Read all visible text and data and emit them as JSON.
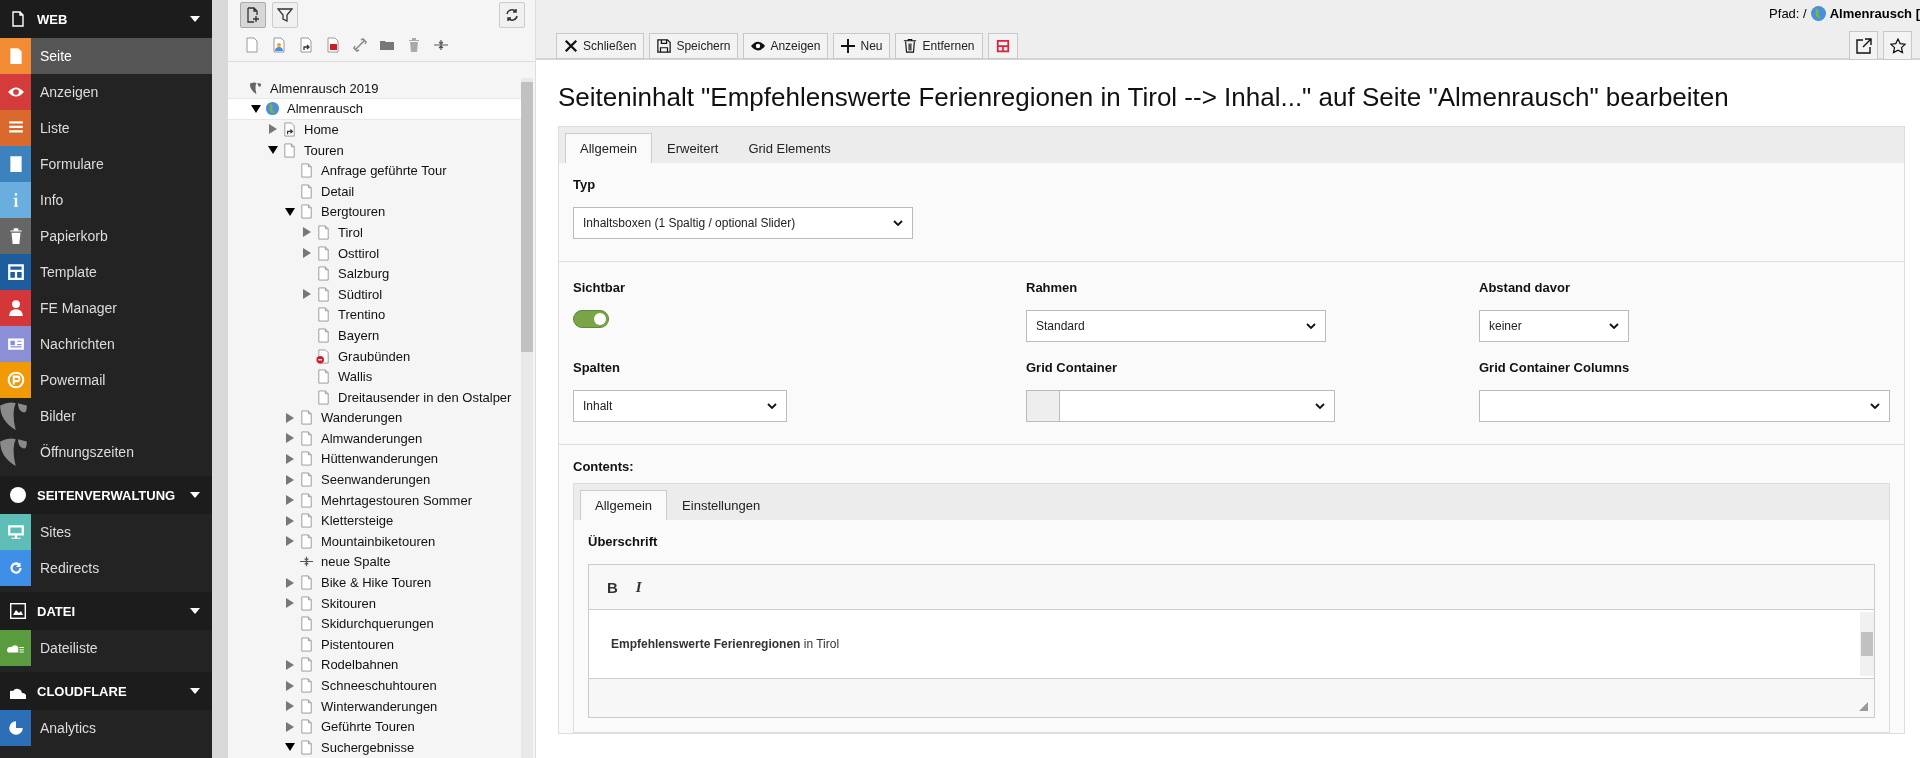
{
  "sidebar": {
    "groups": [
      {
        "title": "WEB",
        "kind": "page",
        "items": [
          {
            "label": "Seite",
            "kind": "page",
            "color": "#f18c34",
            "selected": true
          },
          {
            "label": "Anzeigen",
            "kind": "eye",
            "color": "#d43c3c",
            "selected": false
          },
          {
            "label": "Liste",
            "kind": "list",
            "color": "#d9692d",
            "selected": false
          },
          {
            "label": "Formulare",
            "kind": "form",
            "color": "#3c83bd",
            "selected": false
          },
          {
            "label": "Info",
            "kind": "info",
            "color": "#6aaee0",
            "selected": false
          },
          {
            "label": "Papierkorb",
            "kind": "trash",
            "color": "#666666",
            "selected": false
          },
          {
            "label": "Template",
            "kind": "template",
            "color": "#1d5d9e",
            "selected": false
          },
          {
            "label": "FE Manager",
            "kind": "user",
            "color": "#d3373a",
            "selected": false
          },
          {
            "label": "Nachrichten",
            "kind": "news",
            "color": "#8b8fd6",
            "selected": false
          },
          {
            "label": "Powermail",
            "kind": "powermail",
            "color": "#f29a05",
            "selected": false
          },
          {
            "label": "Bilder",
            "kind": "logo",
            "selected": false
          },
          {
            "label": "Öffnungszeiten",
            "kind": "logo",
            "selected": false
          }
        ]
      },
      {
        "title": "SEITENVERWALTUNG",
        "kind": "globe",
        "items": [
          {
            "label": "Sites",
            "kind": "sites",
            "color": "#5ebdb5",
            "selected": false
          },
          {
            "label": "Redirects",
            "kind": "redirect",
            "color": "#3f8ee8",
            "selected": false
          }
        ]
      },
      {
        "title": "DATEI",
        "kind": "image",
        "items": [
          {
            "label": "Dateiliste",
            "kind": "files",
            "color": "#5a9b3f",
            "selected": false
          }
        ]
      },
      {
        "title": "CLOUDFLARE",
        "kind": "cloud",
        "items": [
          {
            "label": "Analytics",
            "kind": "chart",
            "color": "#2c6fb7",
            "selected": false
          }
        ]
      }
    ]
  },
  "tree_toolbar": {
    "tools": [
      {
        "kind": "new-page",
        "selected": true
      },
      {
        "kind": "filter",
        "selected": false
      }
    ]
  },
  "tree": {
    "children": [
      {
        "label": "Almenrausch 2019",
        "kind": "root",
        "selected": false,
        "children": [
          {
            "label": "Almenrausch",
            "kind": "globe",
            "expanded": true,
            "selected": true,
            "children": [
              {
                "label": "Home",
                "kind": "shortcut",
                "expanded": false,
                "selected": false
              },
              {
                "label": "Touren",
                "kind": "page",
                "expanded": true,
                "selected": false,
                "children": [
                  {
                    "label": "Anfrage geführte Tour",
                    "kind": "page",
                    "selected": false
                  },
                  {
                    "label": "Detail",
                    "kind": "page",
                    "selected": false
                  },
                  {
                    "label": "Bergtouren",
                    "kind": "page",
                    "expanded": true,
                    "selected": false,
                    "children": [
                      {
                        "label": "Tirol",
                        "kind": "page",
                        "expanded": false,
                        "selected": false
                      },
                      {
                        "label": "Osttirol",
                        "kind": "page",
                        "expanded": false,
                        "selected": false
                      },
                      {
                        "label": "Salzburg",
                        "kind": "page",
                        "selected": false
                      },
                      {
                        "label": "Südtirol",
                        "kind": "page",
                        "expanded": false,
                        "selected": false
                      },
                      {
                        "label": "Trentino",
                        "kind": "page",
                        "selected": false
                      },
                      {
                        "label": "Bayern",
                        "kind": "page",
                        "selected": false
                      },
                      {
                        "label": "Graubünden",
                        "kind": "hidden",
                        "selected": false
                      },
                      {
                        "label": "Wallis",
                        "kind": "page",
                        "selected": false
                      },
                      {
                        "label": "Dreitausender in den Ostalper",
                        "kind": "page",
                        "selected": false
                      }
                    ]
                  },
                  {
                    "label": "Wanderungen",
                    "kind": "page",
                    "expanded": false,
                    "selected": false
                  },
                  {
                    "label": "Almwanderungen",
                    "kind": "page",
                    "expanded": false,
                    "selected": false
                  },
                  {
                    "label": "Hüttenwanderungen",
                    "kind": "page",
                    "expanded": false,
                    "selected": false
                  },
                  {
                    "label": "Seenwanderungen",
                    "kind": "page",
                    "expanded": false,
                    "selected": false
                  },
                  {
                    "label": "Mehrtagestouren Sommer",
                    "kind": "page",
                    "expanded": false,
                    "selected": false
                  },
                  {
                    "label": "Klettersteige",
                    "kind": "page",
                    "expanded": false,
                    "selected": false
                  },
                  {
                    "label": "Mountainbiketouren",
                    "kind": "page",
                    "expanded": false,
                    "selected": false
                  },
                  {
                    "label": "neue Spalte",
                    "kind": "divider",
                    "selected": false
                  },
                  {
                    "label": "Bike & Hike Touren",
                    "kind": "page",
                    "expanded": false,
                    "selected": false
                  },
                  {
                    "label": "Skitouren",
                    "kind": "page",
                    "expanded": false,
                    "selected": false
                  },
                  {
                    "label": "Skidurchquerungen",
                    "kind": "page",
                    "selected": false
                  },
                  {
                    "label": "Pistentouren",
                    "kind": "page",
                    "selected": false
                  },
                  {
                    "label": "Rodelbahnen",
                    "kind": "page",
                    "expanded": false,
                    "selected": false
                  },
                  {
                    "label": "Schneeschuhtouren",
                    "kind": "page",
                    "expanded": false,
                    "selected": false
                  },
                  {
                    "label": "Winterwanderungen",
                    "kind": "page",
                    "expanded": false,
                    "selected": false
                  },
                  {
                    "label": "Geführte Touren",
                    "kind": "page",
                    "expanded": false,
                    "selected": false
                  },
                  {
                    "label": "Suchergebnisse",
                    "kind": "page",
                    "expanded": true,
                    "selected": false
                  }
                ]
              }
            ]
          }
        ]
      }
    ]
  },
  "toolbar": {
    "buttons": [
      {
        "label": "Schließen",
        "kind": "close"
      },
      {
        "label": "Speichern",
        "kind": "save"
      },
      {
        "label": "Anzeigen",
        "kind": "eye"
      },
      {
        "label": "Neu",
        "kind": "plus"
      },
      {
        "label": "Entfernen",
        "kind": "trash"
      },
      {
        "kind": "layout"
      }
    ],
    "path": {
      "prefix": "Pfad: /",
      "page": "Almenrausch ["
    }
  },
  "title": "Seiteninhalt \"Empfehlenswerte Ferienregionen in Tirol --> Inhal...\" auf Seite \"Almenrausch\" bearbeiten",
  "tabs": [
    {
      "label": "Allgemein",
      "selected": true
    },
    {
      "label": "Erweitert",
      "selected": false
    },
    {
      "label": "Grid Elements",
      "selected": false
    }
  ],
  "typ": {
    "label": "Typ",
    "value": "Inhaltsboxen (1 Spaltig / optional Slider)"
  },
  "fields": [
    {
      "kind": "toggle",
      "label": "Sichtbar",
      "on": true
    },
    {
      "kind": "select",
      "label": "Rahmen",
      "value": "Standard"
    },
    {
      "kind": "select",
      "label": "Abstand davor",
      "value": "keiner"
    },
    {
      "kind": "select",
      "label": "Spalten",
      "value": "Inhalt"
    },
    {
      "kind": "prefixed",
      "label": "Grid Container"
    },
    {
      "kind": "select",
      "label": "Grid Container Columns"
    }
  ],
  "contents": {
    "label": "Contents:",
    "tabs": [
      {
        "label": "Allgemein",
        "selected": true
      },
      {
        "label": "Einstellungen",
        "selected": false
      }
    ],
    "field_label": "Überschrift",
    "editor": {
      "tools": [
        "B",
        "I"
      ],
      "text": "**Empfehlenswerte Ferienregionen** in Tirol"
    }
  }
}
